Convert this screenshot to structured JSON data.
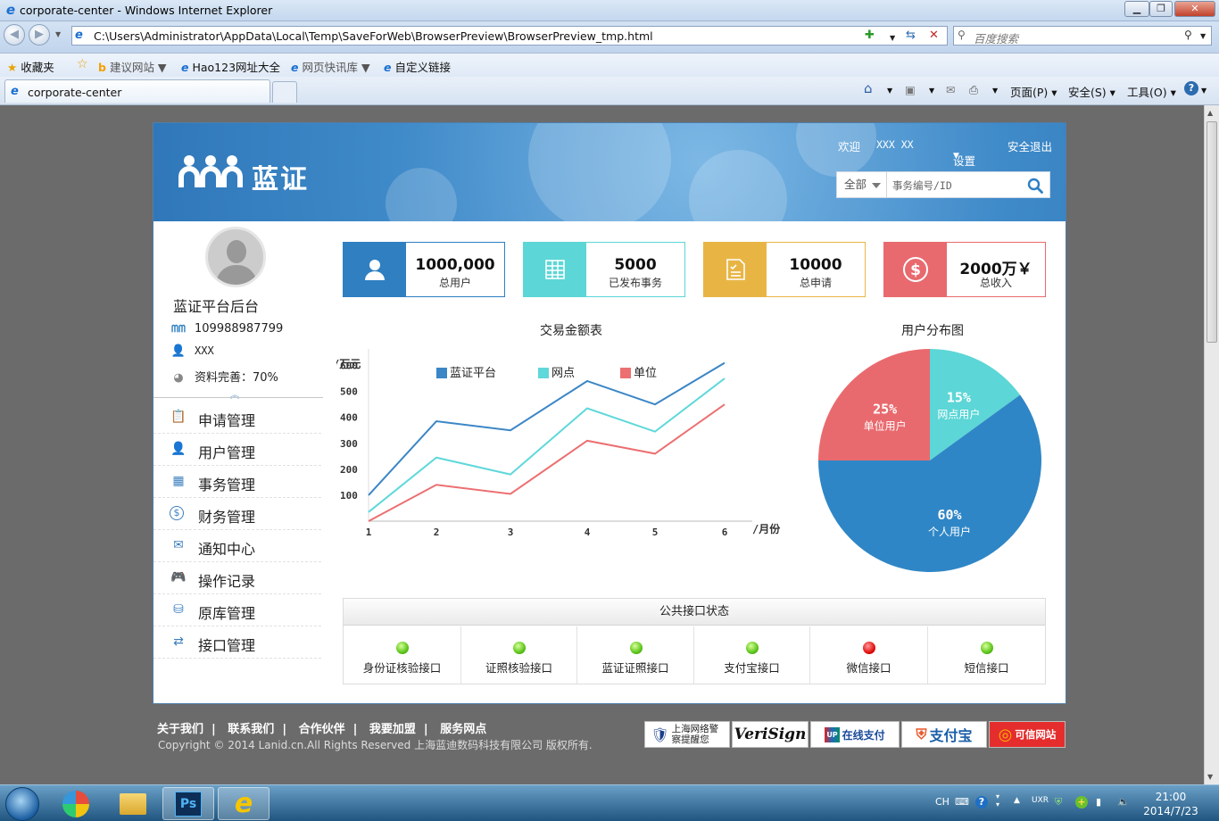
{
  "window": {
    "title": "corporate-center - Windows Internet Explorer"
  },
  "addressbar": {
    "url": "C:\\Users\\Administrator\\AppData\\Local\\Temp\\SaveForWeb\\BrowserPreview\\BrowserPreview_tmp.html",
    "search_placeholder": "百度搜索"
  },
  "favorites": {
    "label": "收藏夹",
    "items": [
      "建议网站 ▼",
      "Hao123网址大全",
      "网页快讯库 ▼",
      "自定义链接"
    ]
  },
  "tab": {
    "title": "corporate-center"
  },
  "commandbar": {
    "page": "页面(P) ▾",
    "safety": "安全(S) ▾",
    "tools": "工具(O) ▾"
  },
  "header": {
    "brand": "蓝证",
    "welcome": "欢迎",
    "user": "XXX XX",
    "settings": "设置",
    "logout": "安全退出",
    "search_scope": "全部",
    "search_placeholder": "事务编号/ID"
  },
  "profile": {
    "name": "蓝证平台后台",
    "account": "109988987799",
    "username": "XXX",
    "completion": "资料完善：70%"
  },
  "menu": [
    {
      "label": "申请管理",
      "icon": "form-icon"
    },
    {
      "label": "用户管理",
      "icon": "user-icon"
    },
    {
      "label": "事务管理",
      "icon": "table-icon"
    },
    {
      "label": "财务管理",
      "icon": "dollar-icon"
    },
    {
      "label": "通知中心",
      "icon": "mail-icon"
    },
    {
      "label": "操作记录",
      "icon": "gamepad-icon"
    },
    {
      "label": "原库管理",
      "icon": "database-icon"
    },
    {
      "label": "接口管理",
      "icon": "interface-icon"
    }
  ],
  "stats": [
    {
      "value": "1000,000",
      "caption": "总用户",
      "color": "#2f7fc1",
      "icon": "user-icon"
    },
    {
      "value": "5000",
      "caption": "已发布事务",
      "color": "#5cd6d6",
      "icon": "table-icon"
    },
    {
      "value": "10000",
      "caption": "总申请",
      "color": "#e8b545",
      "icon": "form-icon"
    },
    {
      "value": "2000万￥",
      "caption": "总收入",
      "color": "#e86a6e",
      "icon": "dollar-icon"
    }
  ],
  "chart_data": [
    {
      "type": "line",
      "title": "交易金额表",
      "ylabel": "/万元",
      "xlabel": "/月份",
      "x": [
        1,
        2,
        3,
        4,
        5,
        6
      ],
      "ylim": [
        0,
        650
      ],
      "yticks": [
        100,
        200,
        300,
        400,
        500,
        600
      ],
      "series": [
        {
          "name": "蓝证平台",
          "color": "#3b86c6",
          "values": [
            100,
            385,
            350,
            540,
            450,
            610
          ]
        },
        {
          "name": "网点",
          "color": "#5fd8da",
          "values": [
            35,
            245,
            180,
            435,
            345,
            550
          ]
        },
        {
          "name": "单位",
          "color": "#ec6f71",
          "values": [
            0,
            140,
            105,
            310,
            260,
            450
          ]
        }
      ],
      "legend": "top"
    },
    {
      "type": "pie",
      "title": "用户分布图",
      "slices": [
        {
          "label": "网点用户",
          "percent": "15%",
          "value": 15,
          "color": "#5cd6d6"
        },
        {
          "label": "个人用户",
          "percent": "60%",
          "value": 60,
          "color": "#2f86c6"
        },
        {
          "label": "单位用户",
          "percent": "25%",
          "value": 25,
          "color": "#e96a6e"
        }
      ]
    }
  ],
  "api_status": {
    "title": "公共接口状态",
    "items": [
      {
        "label": "身份证核验接口",
        "status": "green"
      },
      {
        "label": "证照核验接口",
        "status": "green"
      },
      {
        "label": "蓝证证照接口",
        "status": "green"
      },
      {
        "label": "支付宝接口",
        "status": "green"
      },
      {
        "label": "微信接口",
        "status": "red"
      },
      {
        "label": "短信接口",
        "status": "green"
      }
    ]
  },
  "footer": {
    "links": [
      "关于我们",
      "联系我们",
      "合作伙伴",
      "我要加盟",
      "服务网点"
    ],
    "copyright": "Copyright © 2014 Lanid.cn.All Rights Reserved  上海蓝迪数码科技有限公司  版权所有.",
    "badges": [
      "上海网络警察提醒您",
      "VeriSign",
      "在线支付",
      "支付宝",
      "可信网站"
    ]
  },
  "taskbar": {
    "lang": "CH",
    "time": "21:00",
    "date": "2014/7/23"
  }
}
